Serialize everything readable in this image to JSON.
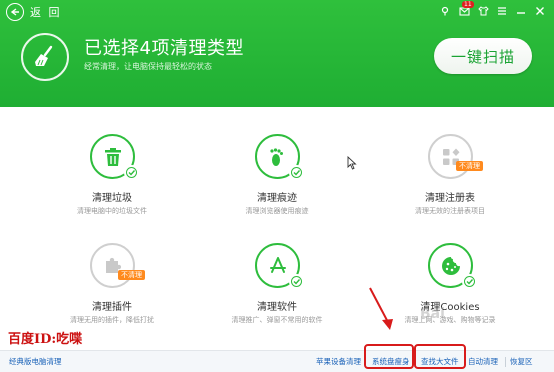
{
  "topbar": {
    "back_label": "返 回",
    "notification_count": "11"
  },
  "header": {
    "title": "已选择4项清理类型",
    "subtitle": "经常清理，让电脑保持最轻松的状态",
    "scan_button": "一键扫描"
  },
  "items": [
    {
      "name": "清理垃圾",
      "desc": "清理电脑中的垃圾文件",
      "icon": "trash-icon",
      "selected": true,
      "tag": ""
    },
    {
      "name": "清理痕迹",
      "desc": "清理浏览器使用痕迹",
      "icon": "footprint-icon",
      "selected": true,
      "tag": ""
    },
    {
      "name": "清理注册表",
      "desc": "清理无效的注册表项目",
      "icon": "registry-icon",
      "selected": false,
      "tag": "不清理"
    },
    {
      "name": "清理插件",
      "desc": "清理无用的插件，降低打扰",
      "icon": "plugin-icon",
      "selected": false,
      "tag": "不清理"
    },
    {
      "name": "清理软件",
      "desc": "清理推广、弹窗不常用的软件",
      "icon": "app-store-icon",
      "selected": true,
      "tag": ""
    },
    {
      "name": "清理Cookies",
      "desc": "清理上网、游戏、购物等记录",
      "icon": "cookie-icon",
      "selected": true,
      "tag": ""
    }
  ],
  "watermark": {
    "id_text": "百度ID:吃喋",
    "logo_text": "Bai"
  },
  "footer": {
    "classic": "经典版电脑清理",
    "apple": "苹果设备清理",
    "slim": "系统盘瘦身",
    "bigfile": "查找大文件",
    "auto": "自动清理",
    "restore": "恢复区"
  },
  "colors": {
    "brand_green": "#1fae33",
    "tag_orange": "#ff8a1e",
    "highlight_red": "#d81b1b",
    "link_blue": "#1a62b8"
  }
}
